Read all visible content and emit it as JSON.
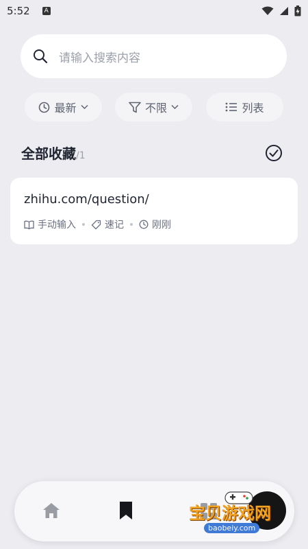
{
  "status_bar": {
    "time": "5:52",
    "app_icon_letter": "A",
    "icons": [
      "wifi-icon",
      "signal-icon",
      "battery-icon"
    ]
  },
  "search": {
    "placeholder": "请输入搜索内容",
    "icon": "search-icon"
  },
  "filters": [
    {
      "label": "最新",
      "icon": "clock-icon",
      "trailing_icon": "chevron-down-icon"
    },
    {
      "label": "不限",
      "icon": "filter-icon",
      "trailing_icon": "chevron-down-icon"
    },
    {
      "label": "列表",
      "icon": "list-icon"
    }
  ],
  "section": {
    "title": "全部收藏",
    "count_separator": "/",
    "count": "1"
  },
  "items": [
    {
      "title": "zhihu.com/question/",
      "source": "手动输入",
      "tag": "速记",
      "time": "刚刚"
    }
  ],
  "bottom_nav": {
    "items": [
      "home-icon",
      "bookmark-icon",
      "grid-icon"
    ],
    "active_index": 1
  },
  "watermark": {
    "text": "宝贝游戏网",
    "url": "baobeiy.com"
  },
  "colors": {
    "background": "#ececf1",
    "card": "#ffffff",
    "primary_text": "#1f2430",
    "secondary_text": "#6b7080",
    "placeholder": "#9ca0ab"
  }
}
